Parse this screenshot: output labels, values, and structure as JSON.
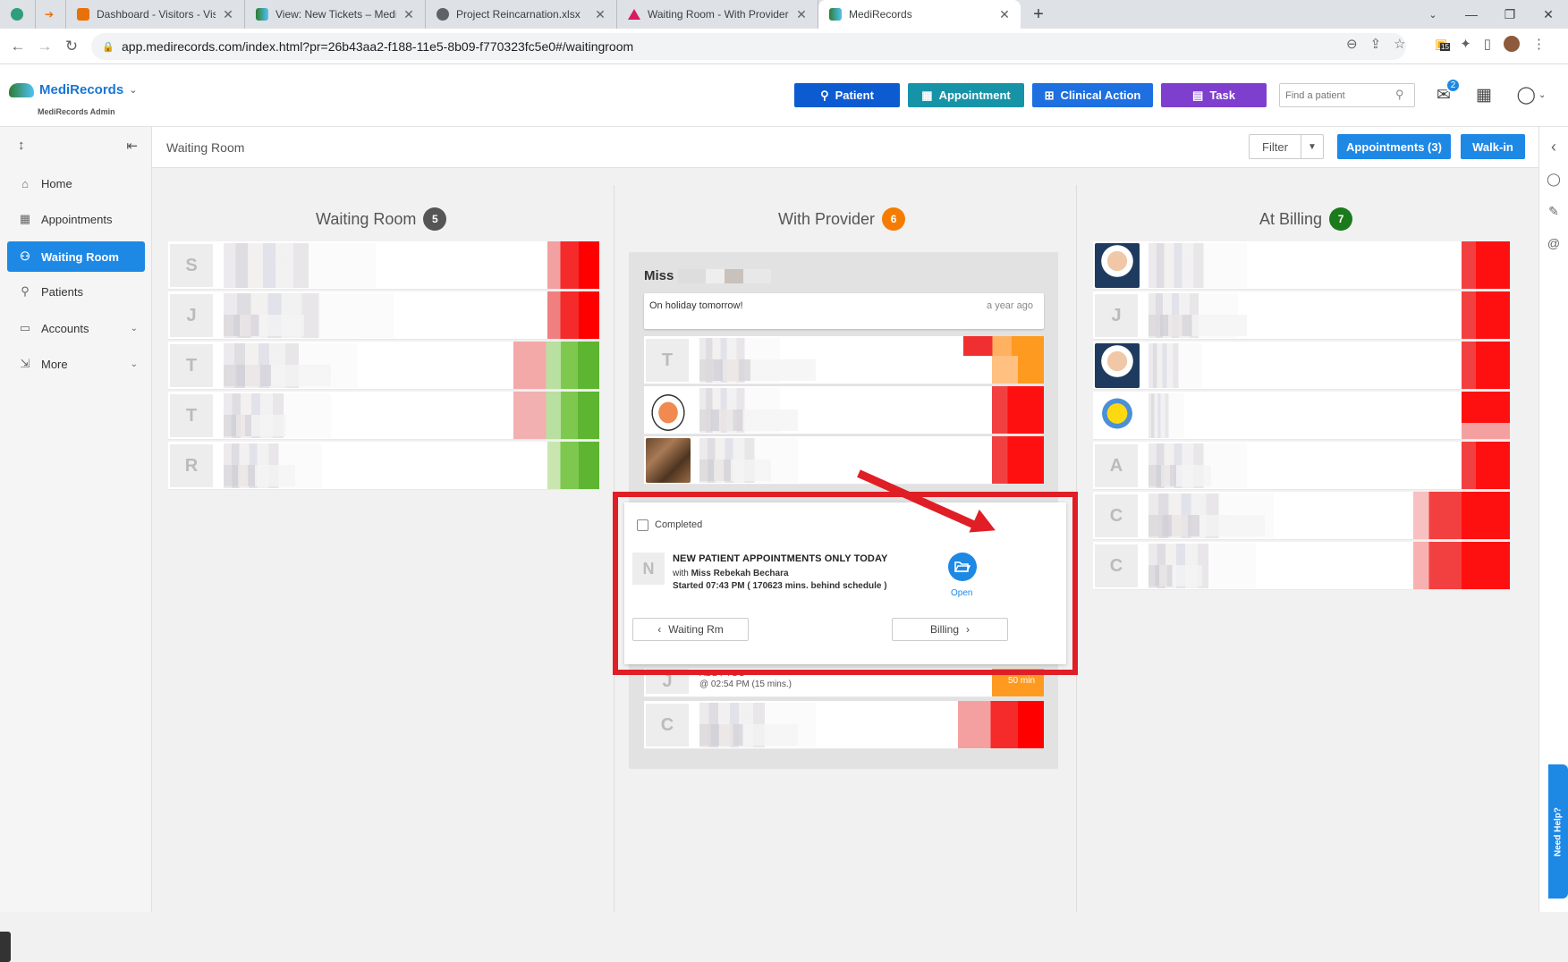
{
  "browser": {
    "tabs": [
      {
        "label": "",
        "icon": "chatgpt-icon"
      },
      {
        "label": "",
        "icon": "arrow-icon"
      },
      {
        "label": "Dashboard - Visitors - Visitor list",
        "icon": "dashboard-icon"
      },
      {
        "label": "View: New Tickets – MediRecords",
        "icon": "medirecords-icon"
      },
      {
        "label": "Project Reincarnation.xlsx",
        "icon": "globe-icon"
      },
      {
        "label": "Waiting Room - With Provider",
        "icon": "triangle-icon"
      },
      {
        "label": "MediRecords",
        "icon": "medirecords-icon",
        "active": true
      }
    ],
    "url": "app.medirecords.com/index.html?pr=26b43aa2-f188-11e5-8b09-f770323fc5e0#/waitingroom",
    "extension_badge": "15"
  },
  "header": {
    "logo_text": "MediRecords",
    "logo_sub": "MediRecords Admin",
    "buttons": [
      {
        "label": "Patient",
        "color": "#0d5bd1"
      },
      {
        "label": "Appointment",
        "color": "#1793a8"
      },
      {
        "label": "Clinical Action",
        "color": "#1e6fe0"
      },
      {
        "label": "Task",
        "color": "#7e3fcf"
      }
    ],
    "search_placeholder": "Find a patient",
    "mail_badge": "2"
  },
  "sidebar": {
    "items": [
      {
        "label": "Home",
        "icon": "home-icon"
      },
      {
        "label": "Appointments",
        "icon": "calendar-icon"
      },
      {
        "label": "Waiting Room",
        "icon": "waiting-icon",
        "active": true
      },
      {
        "label": "Patients",
        "icon": "patients-icon"
      },
      {
        "label": "Accounts",
        "icon": "folder-icon",
        "expandable": true
      },
      {
        "label": "More",
        "icon": "more-icon",
        "expandable": true
      }
    ]
  },
  "main": {
    "breadcrumb": "Waiting Room",
    "filter_label": "Filter",
    "appointments_label": "Appointments (3)",
    "walkin_label": "Walk-in",
    "columns": [
      {
        "title": "Waiting Room",
        "count": "5",
        "badge_color": "#555555"
      },
      {
        "title": "With Provider",
        "count": "6",
        "badge_color": "#f57c00"
      },
      {
        "title": "At Billing",
        "count": "7",
        "badge_color": "#1b7a1b"
      }
    ],
    "waiting_initials": [
      "S",
      "J",
      "T",
      "T",
      "R"
    ],
    "provider_name_prefix": "Miss",
    "note_text": "On holiday tomorrow!",
    "note_time": "a year ago",
    "provider_initials": [
      "T",
      "",
      "",
      "J",
      "C"
    ],
    "billing_initials": [
      "",
      "J",
      "",
      "",
      "A",
      "C",
      "C"
    ],
    "peek_time": "@ 02:54 PM (15 mins.)",
    "peek_top": "ADDT TOO",
    "peek_badge": "50 min"
  },
  "popup": {
    "completed_label": "Completed",
    "initial": "N",
    "title": "NEW PATIENT APPOINTMENTS ONLY TODAY",
    "with_prefix": "with",
    "provider": "Miss Rebekah Bechara",
    "started": "Started 07:43 PM ( 170623 mins. behind schedule )",
    "open_label": "Open",
    "back_label": "Waiting Rm",
    "forward_label": "Billing"
  },
  "rail": {
    "need_help": "Need Help?"
  }
}
